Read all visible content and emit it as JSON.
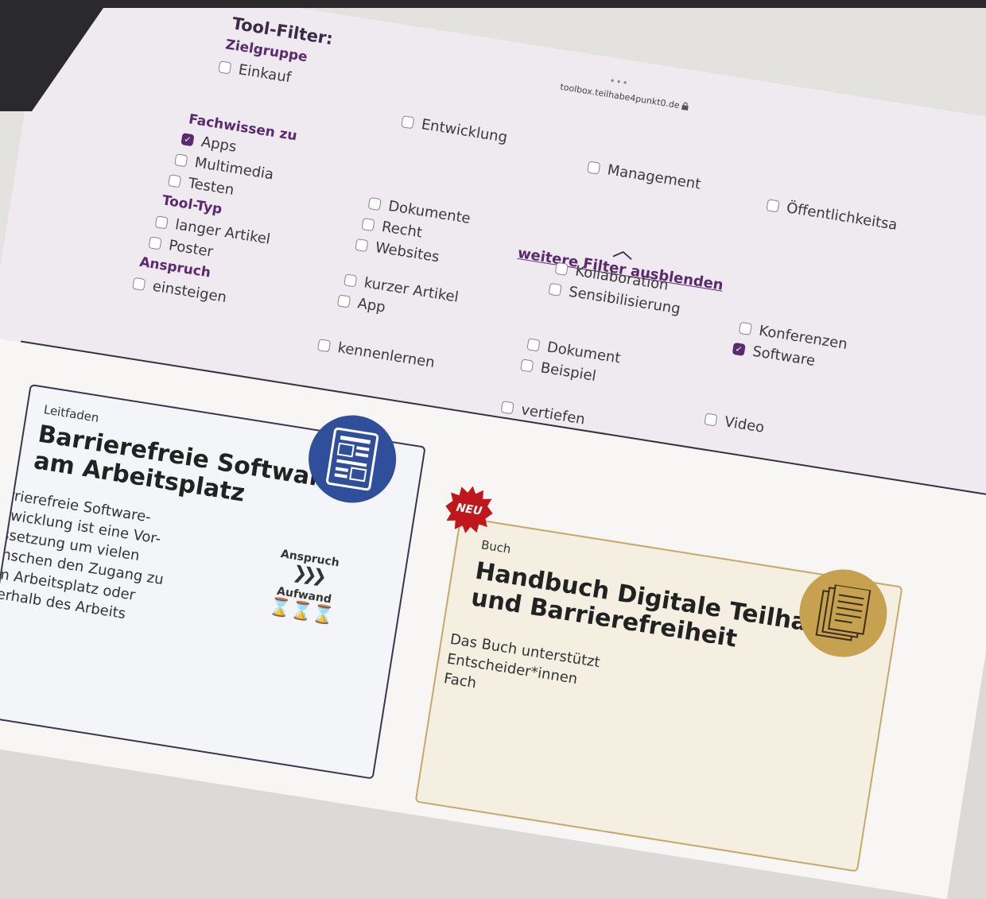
{
  "browser": {
    "url": "toolbox.teilhabe4punkt0.de",
    "lock_icon": "lock-icon",
    "menu_dots": "•••"
  },
  "filter": {
    "title": "Tool-Filter:",
    "zielgruppe": {
      "label": "Zielgruppe",
      "options": [
        "Einkauf",
        "Entwicklung",
        "Management",
        "Öffentlichkeitsa"
      ]
    },
    "toggle_label": "weitere Filter ausblenden",
    "fachwissen": {
      "label": "Fachwissen zu",
      "options": [
        "Apps",
        "Multimedia",
        "Testen",
        "Dokumente",
        "Recht",
        "Websites",
        "Kollaboration",
        "Sensibilisierung",
        "Konferenzen",
        "Software"
      ],
      "checked": [
        "Apps",
        "Software"
      ]
    },
    "tooltyp": {
      "label": "Tool-Typ",
      "options": [
        "langer Artikel",
        "Poster",
        "kurzer Artikel",
        "App",
        "Dokument",
        "Beispiel",
        "Video"
      ]
    },
    "anspruch": {
      "label": "Anspruch",
      "options": [
        "einsteigen",
        "kennenlernen",
        "vertiefen"
      ]
    }
  },
  "cards": [
    {
      "category": "Leitfaden",
      "title": "Barrierefreie Software am Arbeitsplatz",
      "text_lines": [
        "Barrierefreie Software-",
        "entwicklung ist eine Vor-",
        "aussetzung um vielen",
        "Menschen den Zugang zu",
        "dem Arbeitsplatz oder",
        "innerhalb des Arbeits"
      ],
      "anspruch_label": "Anspruch",
      "aufwand_label": "Aufwand",
      "icon": "document-image-icon",
      "accent": "#2f4f9b"
    },
    {
      "badge": "NEU",
      "category": "Buch",
      "title": "Handbuch Digitale Teilhabe und Barrierefreiheit",
      "text_lines": [
        "Das Buch unterstützt",
        "Entscheider*innen",
        "Fach"
      ],
      "icon": "pages-icon",
      "accent": "#c6a14f"
    }
  ],
  "colors": {
    "primary": "#5b2a6e",
    "filter_bg": "#efe9f0",
    "badge": "#c0171c"
  }
}
